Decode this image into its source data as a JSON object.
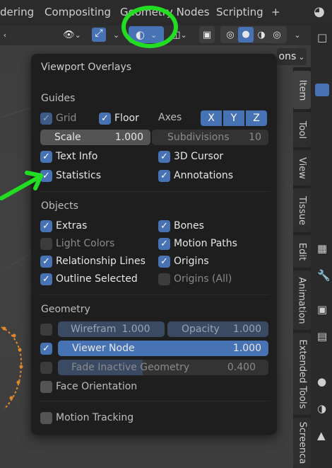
{
  "topbar": {
    "tabs": [
      "dering",
      "Compositing",
      "Geometry Nodes",
      "Scripting",
      "+"
    ]
  },
  "header": {
    "options_label": "ons"
  },
  "npanel": {
    "tabs": [
      "Item",
      "Tool",
      "View",
      "Tissue",
      "Edit",
      "Animation",
      "Extended Tools",
      "Screenca"
    ]
  },
  "overlay": {
    "title": "Viewport Overlays",
    "guides": {
      "section": "Guides",
      "grid": {
        "label": "Grid",
        "checked": true
      },
      "floor": {
        "label": "Floor",
        "checked": true
      },
      "axes_label": "Axes",
      "axes": [
        "X",
        "Y",
        "Z"
      ],
      "scale_label": "Scale",
      "scale_value": "1.000",
      "subdiv_label": "Subdivisions",
      "subdiv_value": "10",
      "text_info": {
        "label": "Text Info",
        "checked": true
      },
      "cursor3d": {
        "label": "3D Cursor",
        "checked": true
      },
      "statistics": {
        "label": "Statistics",
        "checked": true
      },
      "annotations": {
        "label": "Annotations",
        "checked": true
      }
    },
    "objects": {
      "section": "Objects",
      "extras": {
        "label": "Extras",
        "checked": true
      },
      "bones": {
        "label": "Bones",
        "checked": true
      },
      "light_colors": {
        "label": "Light Colors",
        "checked": false
      },
      "motion_paths": {
        "label": "Motion Paths",
        "checked": true
      },
      "relationship_lines": {
        "label": "Relationship Lines",
        "checked": true
      },
      "origins": {
        "label": "Origins",
        "checked": true
      },
      "outline_selected": {
        "label": "Outline Selected",
        "checked": true
      },
      "origins_all": {
        "label": "Origins (All)",
        "checked": false
      }
    },
    "geometry": {
      "section": "Geometry",
      "wireframe_label": "Wirefram",
      "wireframe_value": "1.000",
      "opacity_label": "Opacity",
      "opacity_value": "1.000",
      "viewer_node_label": "Viewer Node",
      "viewer_node_value": "1.000",
      "fade_label": "Fade Inactive Geometry",
      "fade_value": "0.400",
      "face_orientation": {
        "label": "Face Orientation",
        "checked": false
      },
      "motion_tracking": {
        "label": "Motion Tracking",
        "checked": false
      }
    }
  },
  "colors": {
    "accent": "#4772b3",
    "annotation": "#22dd22",
    "popover_bg": "#1e1e1e"
  }
}
